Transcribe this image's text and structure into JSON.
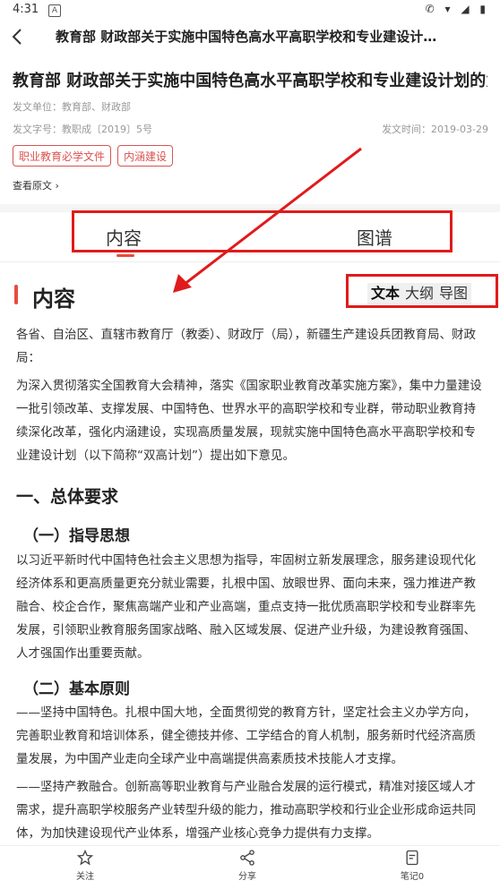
{
  "status": {
    "time": "4:31",
    "app_badge": "A",
    "icons": "✆ ▾ ◢ ▮"
  },
  "nav": {
    "title": "教育部 财政部关于实施中国特色高水平高职学校和专业建设计划…"
  },
  "doc": {
    "title": "教育部 财政部关于实施中国特色高水平高职学校和专业建设计划的意见",
    "unit": "发文单位：教育部、财政部",
    "number": "发文字号：教职成〔2019〕5号",
    "date": "发文时间：2019-03-29",
    "tags": [
      "职业教育必学文件",
      "内涵建设"
    ],
    "view_original": "查看原文 ›"
  },
  "tabs": [
    "内容",
    "图谱"
  ],
  "section": {
    "title": "内容",
    "modes": [
      "文本",
      "大纲",
      "导图"
    ]
  },
  "content": {
    "p1": "各省、自治区、直辖市教育厅（教委）、财政厅（局），新疆生产建设兵团教育局、财政局：",
    "p2": "为深入贯彻落实全国教育大会精神，落实《国家职业教育改革实施方案》，集中力量建设一批引领改革、支撑发展、中国特色、世界水平的高职学校和专业群，带动职业教育持续深化改革，强化内涵建设，实现高质量发展，现就实施中国特色高水平高职学校和专业建设计划（以下简称“双高计划”）提出如下意见。",
    "h1": "一、总体要求",
    "h2a": "（一）指导思想",
    "p3": "以习近平新时代中国特色社会主义思想为指导，牢固树立新发展理念，服务建设现代化经济体系和更高质量更充分就业需要，扎根中国、放眼世界、面向未来，强力推进产教融合、校企合作，聚焦高端产业和产业高端，重点支持一批优质高职学校和专业群率先发展，引领职业教育服务国家战略、融入区域发展、促进产业升级，为建设教育强国、人才强国作出重要贡献。",
    "h2b": "（二）基本原则",
    "p4": "——坚持中国特色。扎根中国大地，全面贯彻党的教育方针，坚定社会主义办学方向，完善职业教育和培训体系，健全德技并修、工学结合的育人机制，服务新时代经济高质量发展，为中国产业走向全球产业中高端提供高素质技术技能人才支撑。",
    "p5": "——坚持产教融合。创新高等职业教育与产业融合发展的运行模式，精准对接区域人才需求，提升高职学校服务产业转型升级的能力，推动高职学校和行业企业形成命运共同体，为加快建设现代产业体系，增强产业核心竞争力提供有力支撑。"
  },
  "bottom": {
    "follow": "关注",
    "share": "分享",
    "notes": "笔记0"
  },
  "colors": {
    "accent": "#e74c3c",
    "annotation": "#e01b1b"
  }
}
